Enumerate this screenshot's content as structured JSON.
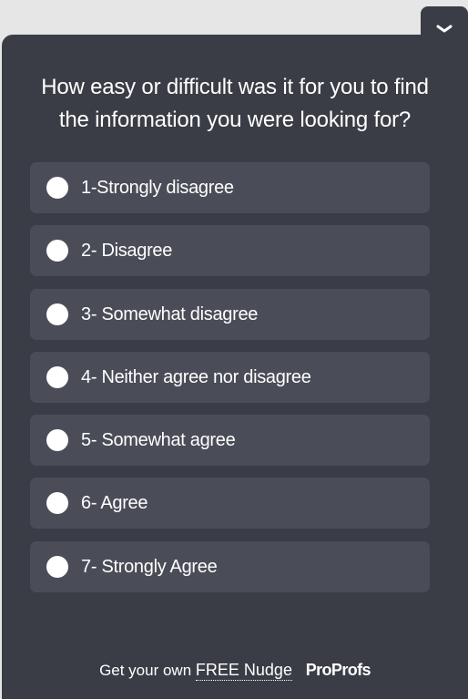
{
  "widget": {
    "collapse_icon": "chevron-down-icon",
    "question": "How easy or difficult was it for you to find the information you were looking for?",
    "options": [
      {
        "label": "1-Strongly disagree"
      },
      {
        "label": "2- Disagree"
      },
      {
        "label": "3- Somewhat disagree"
      },
      {
        "label": "4- Neither agree nor disagree"
      },
      {
        "label": "5- Somewhat agree"
      },
      {
        "label": "6- Agree"
      },
      {
        "label": "7- Strongly Agree"
      }
    ],
    "footer": {
      "prefix": "Get your own",
      "link_text": "FREE Nudge",
      "brand": "ProProfs"
    }
  },
  "colors": {
    "page_background": "#e6e6e6",
    "panel_background": "#3a3d45",
    "option_background": "#4a4d57",
    "text": "#ffffff"
  }
}
